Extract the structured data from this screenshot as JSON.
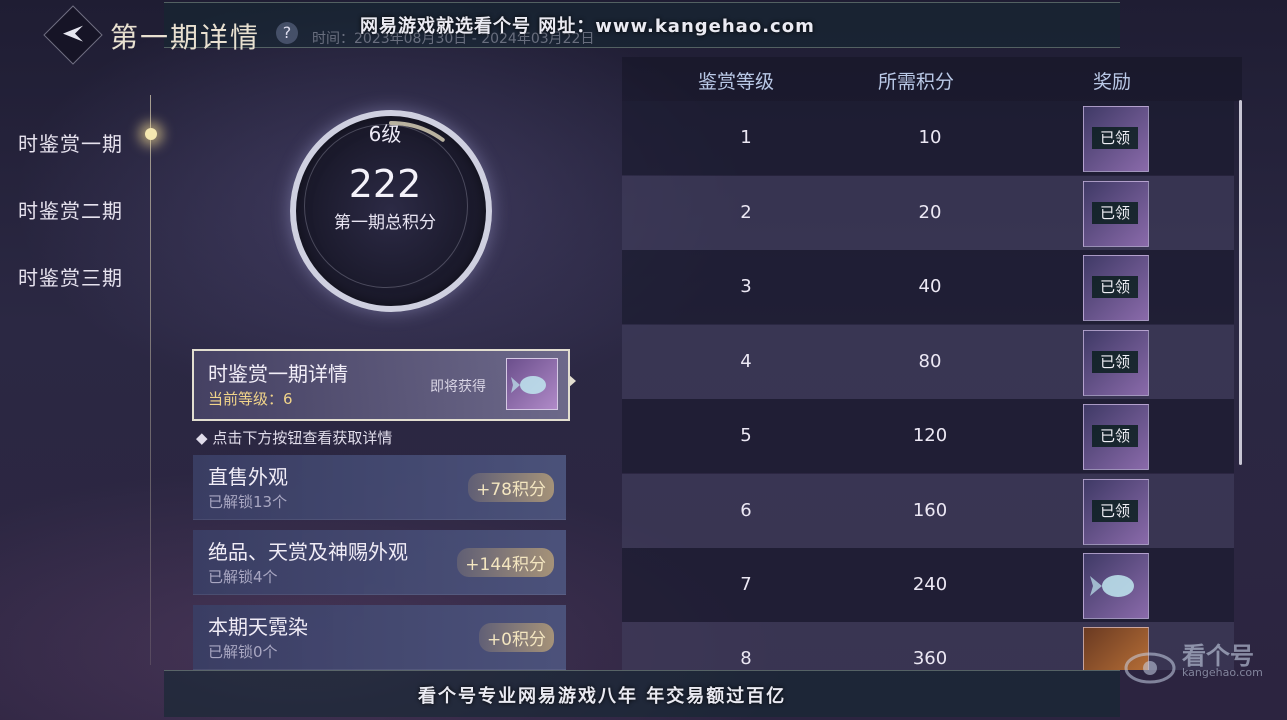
{
  "header": {
    "title": "第一期详情",
    "help": "?",
    "time_text": "时间：2023年08月30日 - 2024年03月22日",
    "watermark": "网易游戏就选看个号  网址：www.kangehao.com"
  },
  "sidebar": {
    "items": [
      {
        "label": "时鉴赏一期"
      },
      {
        "label": "时鉴赏二期"
      },
      {
        "label": "时鉴赏三期"
      }
    ]
  },
  "summary": {
    "level_label": "6级",
    "level_progress": 0.1,
    "score": "222",
    "score_label": "第一期总积分"
  },
  "detail_card": {
    "title": "时鉴赏一期详情",
    "current_level": "当前等级：6",
    "obtain_label": "即将获得"
  },
  "hint": "点击下方按钮查看获取详情",
  "categories": [
    {
      "title": "直售外观",
      "sub": "已解锁13个",
      "points": "+78积分"
    },
    {
      "title": "绝品、天赏及神赐外观",
      "sub": "已解锁4个",
      "points": "+144积分"
    },
    {
      "title": "本期天霓染",
      "sub": "已解锁0个",
      "points": "+0积分"
    }
  ],
  "table": {
    "headers": [
      "鉴赏等级",
      "所需积分",
      "奖励"
    ],
    "rows": [
      {
        "level": "1",
        "points": "10",
        "claimed": "已领"
      },
      {
        "level": "2",
        "points": "20",
        "claimed": "已领"
      },
      {
        "level": "3",
        "points": "40",
        "claimed": "已领"
      },
      {
        "level": "4",
        "points": "80",
        "claimed": "已领"
      },
      {
        "level": "5",
        "points": "120",
        "claimed": "已领"
      },
      {
        "level": "6",
        "points": "160",
        "claimed": "已领"
      },
      {
        "level": "7",
        "points": "240",
        "claimed": ""
      },
      {
        "level": "8",
        "points": "360",
        "claimed": ""
      }
    ]
  },
  "footer": {
    "watermark": "看个号专业网易游戏八年  年交易额过百亿",
    "logo_main": "看个号",
    "logo_sub": "kangehao.com"
  },
  "colors": {
    "accent_gold": "#f1d48a",
    "header_blue": "#b9c8e6"
  }
}
